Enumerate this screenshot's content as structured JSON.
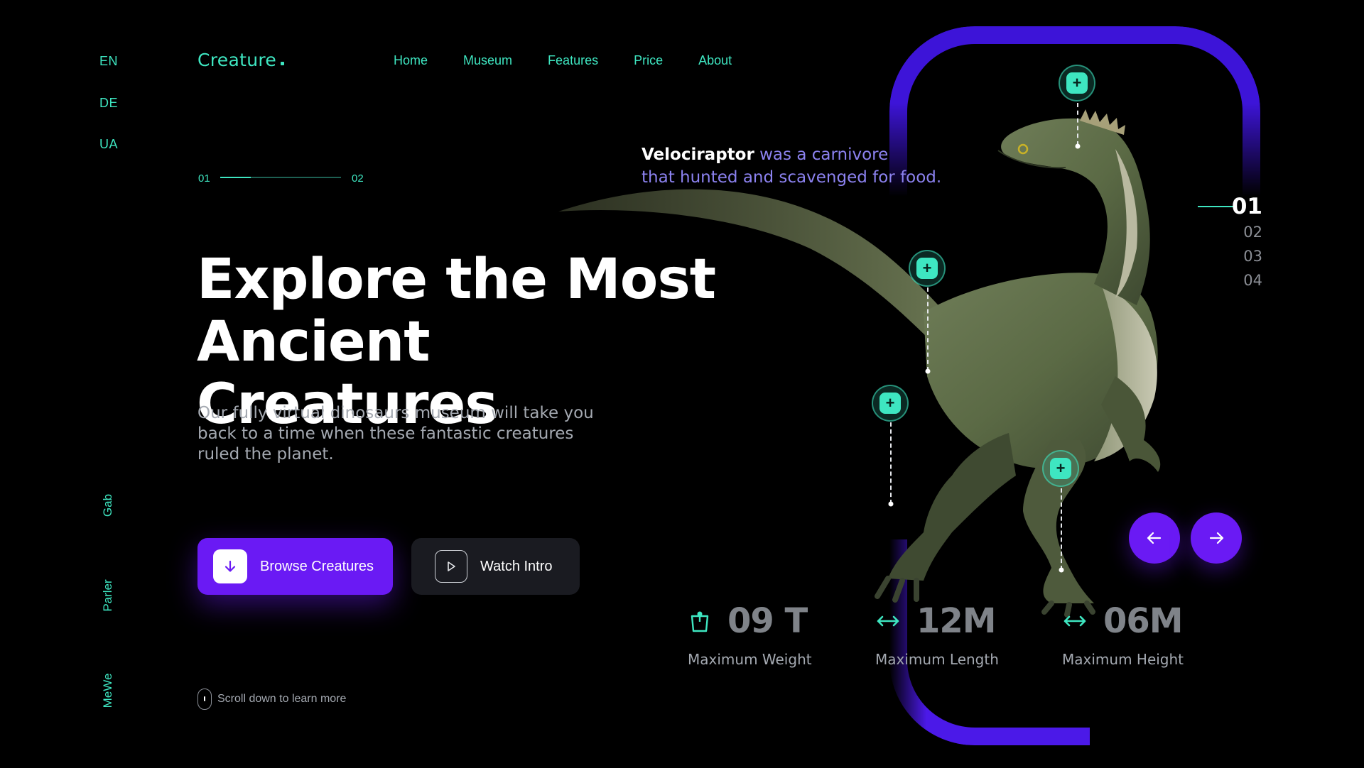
{
  "languages": [
    "EN",
    "DE",
    "UA"
  ],
  "socials": [
    "Gab",
    "Parler",
    "MeWe"
  ],
  "logo": "Creature",
  "nav": [
    "Home",
    "Museum",
    "Features",
    "Price",
    "About"
  ],
  "pager": {
    "current": "01",
    "next": "02",
    "progress": 0.25
  },
  "hero": {
    "title_line1": "Explore the Most",
    "title_line2": "Ancient Creatures",
    "lead": "Our fully virtual dinosaurs museum will take you back to a time when these fantastic creatures ruled the planet."
  },
  "buttons": {
    "browse": "Browse Creatures",
    "watch": "Watch Intro"
  },
  "scroll_hint": "Scroll down to learn more",
  "caption": {
    "name": "Velociraptor",
    "line1_rest": " was a carnivore",
    "line2": "that hunted and scavenged for food."
  },
  "slides": [
    "01",
    "02",
    "03",
    "04"
  ],
  "active_slide": "01",
  "stats": [
    {
      "value": "09 T",
      "caption": "Maximum Weight",
      "icon": "weight-icon"
    },
    {
      "value": "12M",
      "caption": "Maximum Length",
      "icon": "length-arrows-icon"
    },
    {
      "value": "06M",
      "caption": "Maximum Height",
      "icon": "height-arrows-icon"
    }
  ],
  "colors": {
    "accent": "#3ee6c1",
    "primary": "#6a1af4",
    "frame": "#3d14d8",
    "background": "#000000"
  }
}
